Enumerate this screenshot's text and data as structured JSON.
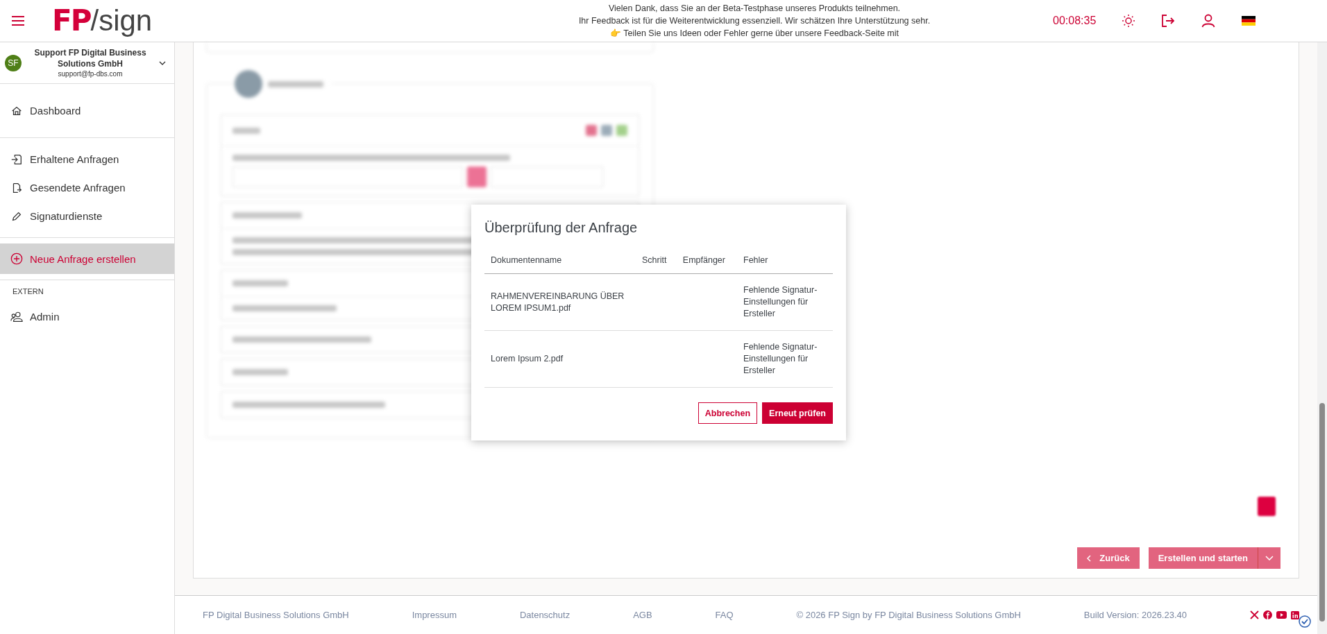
{
  "header": {
    "logo": {
      "mark": "FP",
      "suffix": "/sign"
    },
    "notice": [
      "Vielen Dank, dass Sie an der Beta-Testphase unseres Produkts teilnehmen.",
      "Ihr Feedback ist für die Weiterentwicklung essenziell. Wir schätzen Ihre Unterstützung sehr.",
      "👉 Teilen Sie uns Ideen oder Fehler gerne über unsere Feedback-Seite mit"
    ],
    "timer": "00:08:35"
  },
  "sidebar": {
    "account": {
      "initials": "SF",
      "name": "Support FP Digital Business Solutions GmbH",
      "email": "support@fp-dbs.com"
    },
    "groups": [
      {
        "items": [
          {
            "label": "Dashboard",
            "selected": false
          }
        ]
      },
      {
        "items": [
          {
            "label": "Erhaltene Anfragen",
            "selected": false
          },
          {
            "label": "Gesendete Anfragen",
            "selected": false
          },
          {
            "label": "Signaturdienste",
            "selected": false
          }
        ]
      },
      {
        "items": [
          {
            "label": "Neue Anfrage erstellen",
            "selected": true
          }
        ]
      },
      {
        "label": "EXTERN",
        "items": [
          {
            "label": "Admin",
            "selected": false
          }
        ]
      }
    ]
  },
  "dialog": {
    "title": "Überprüfung der Anfrage",
    "columns": [
      "Dokumentenname",
      "Schritt",
      "Empfänger",
      "Fehler"
    ],
    "rows": [
      {
        "document": "RAHMENVEREINBARUNG ÜBER LOREM IPSUM1.pdf",
        "error": "Fehlende Signatur-Einstellungen für Ersteller"
      },
      {
        "document": "Lorem Ipsum 2.pdf",
        "error": "Fehlende Signatur-Einstellungen für Ersteller"
      }
    ],
    "buttons": {
      "cancel": "Abbrechen",
      "confirm": "Erneut prüfen"
    }
  },
  "actions": {
    "back": "Zurück",
    "create": "Erstellen und starten"
  },
  "footer": {
    "links": [
      "FP Digital Business Solutions GmbH",
      "Impressum",
      "Datenschutz",
      "AGB",
      "FAQ"
    ],
    "copyright": "© 2026 FP Sign by FP Digital Business Solutions GmbH",
    "build": "Build Version: 2026.23.40"
  }
}
